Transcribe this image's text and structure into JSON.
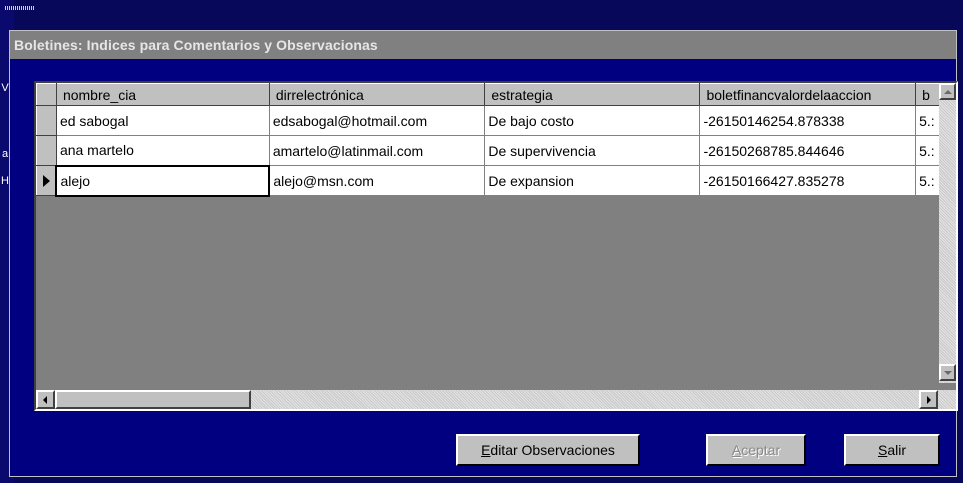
{
  "backdrop": {
    "left_fragments": [
      "V",
      "a",
      "H"
    ]
  },
  "dialog": {
    "title": "Boletines: Indices para Comentarios y Observacionas"
  },
  "grid": {
    "columns": [
      "nombre_cia",
      "dirrelectrónica",
      "estrategia",
      "boletfinancvalordelaaccion",
      "b"
    ],
    "rows": [
      [
        "ed sabogal",
        "edsabogal@hotmail.com",
        "De bajo costo",
        "-26150146254.878338",
        "5.:"
      ],
      [
        "ana martelo",
        "amartelo@latinmail.com",
        "De supervivencia",
        "-26150268785.844646",
        "5.:"
      ],
      [
        "alejo",
        "alejo@msn.com",
        "De expansion",
        "-26150166427.835278",
        "5.:"
      ]
    ],
    "current_row": 2
  },
  "buttons": {
    "edit": {
      "first": "E",
      "rest": "ditar Observaciones"
    },
    "accept": {
      "first": "A",
      "rest": "ceptar"
    },
    "exit": {
      "first": "S",
      "rest": "alir"
    }
  },
  "icons": {
    "scroll_up": "triangle-up",
    "scroll_down": "triangle-down",
    "scroll_left": "triangle-left",
    "scroll_right": "triangle-right",
    "row_pointer": "triangle-right"
  }
}
